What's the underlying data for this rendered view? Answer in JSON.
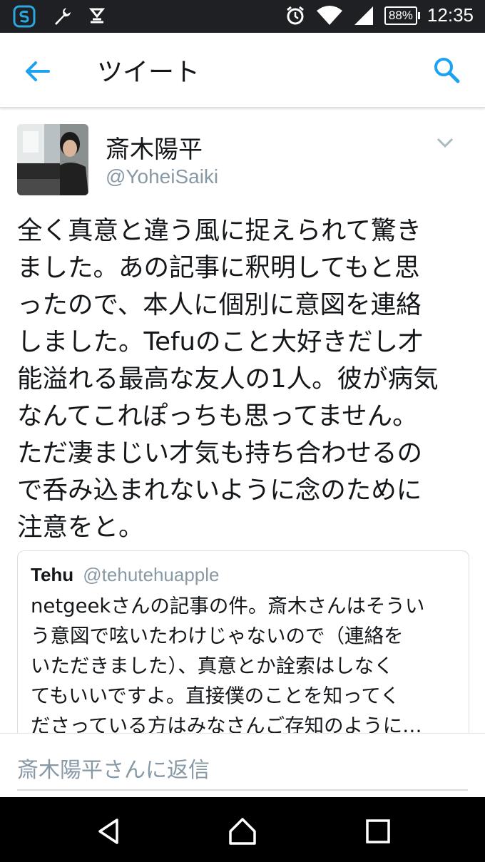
{
  "status_bar": {
    "battery": "88%",
    "time": "12:35",
    "icons": [
      "app-s-icon",
      "wrench-icon",
      "dock-icon",
      "alarm-icon",
      "wifi-icon",
      "signal-icon",
      "battery-icon"
    ]
  },
  "app_bar": {
    "title": "ツイート",
    "back_icon": "back-arrow-icon",
    "search_icon": "search-icon"
  },
  "tweet": {
    "name": "斎木陽平",
    "handle": "@YoheiSaiki",
    "lines": [
      "全く真意と違う風に捉えられて驚き",
      "ました。あの記事に釈明してもと思",
      "ったので、本人に個別に意図を連絡",
      "しました。Tefuのこと大好きだし才",
      "能溢れる最高な友人の1人。彼が病気",
      "なんてこれぽっちも思ってません。",
      "ただ凄まじい才気も持ち合わせるの",
      "で呑み込まれないように念のために",
      "注意をと。"
    ]
  },
  "quoted_tweet": {
    "name": "Tehu",
    "handle": "@tehutehuapple",
    "lines": [
      "netgeekさんの記事の件。斎木さんはそうい",
      "う意図で呟いたわけじゃないので（連絡を",
      "いただきました）、真意とか詮索はしなく",
      "てもいいですよ。直接僕のことを知ってく",
      "ださっている方はみなさんご存知のように…"
    ]
  },
  "reply": {
    "placeholder": "斎木陽平さんに返信"
  },
  "nav": {
    "icons": [
      "back-triangle-icon",
      "home-icon",
      "recent-apps-icon"
    ]
  },
  "colors": {
    "accent": "#1da1f2",
    "status_bar": "#1f2023",
    "nav_bar": "#000000",
    "secondary_text": "#8899a6"
  }
}
